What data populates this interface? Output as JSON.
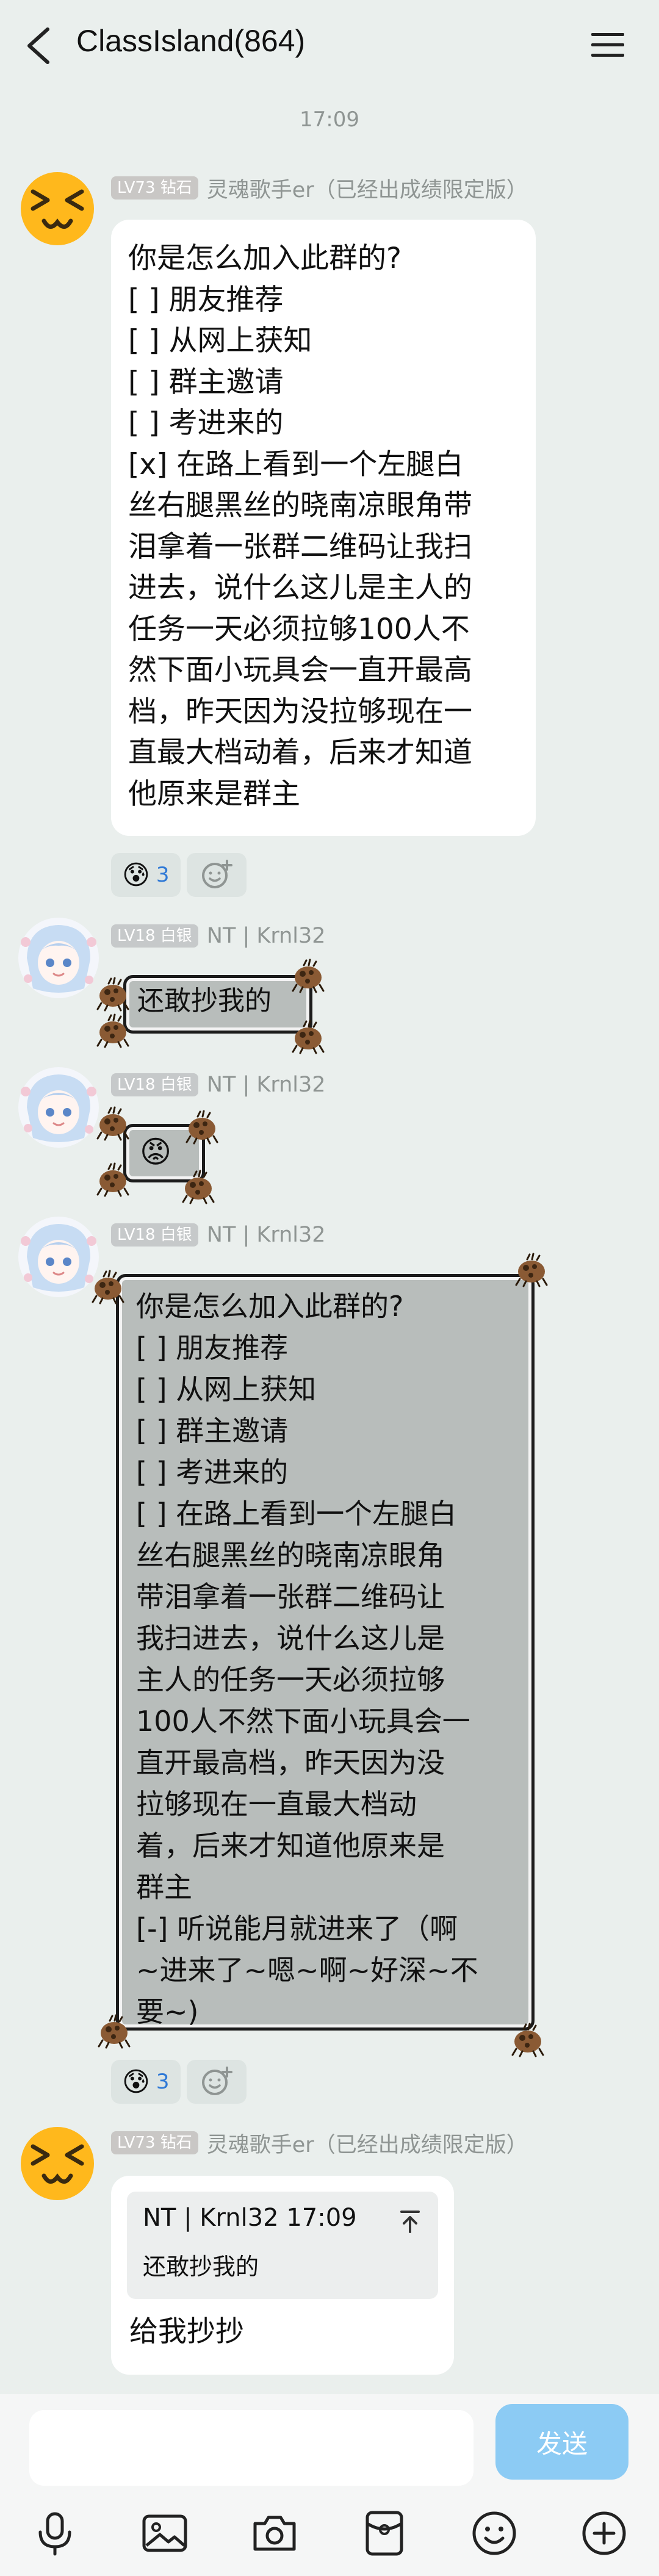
{
  "header": {
    "title": "ClassIsland(864)",
    "time": "17:09"
  },
  "messages": [
    {
      "level": "LV73 钻石",
      "nickname": "灵魂歌手er（已经出成绩限定版）",
      "avatar_icon": "squint-emoji-avatar",
      "text": "你是怎么加入此群的?\n[ ] 朋友推荐\n[ ] 从网上获知\n[ ] 群主邀请\n[ ] 考进来的\n[x] 在路上看到一个左腿白\n丝右腿黑丝的晓南凉眼角带\n泪拿着一张群二维码让我扫\n进去，说什么这儿是主人的\n任务一天必须拉够100人不\n然下面小玩具会一直开最高\n档，昨天因为没拉够现在一\n直最大档动着，后来才知道\n他原来是群主",
      "reaction": {
        "emoji": "😰",
        "count": "3"
      }
    },
    {
      "level": "LV18 白银",
      "nickname": "NT | Krnl32",
      "avatar_icon": "anime-girl-avatar",
      "text": "还敢抄我的"
    },
    {
      "level": "LV18 白银",
      "nickname": "NT | Krnl32",
      "avatar_icon": "anime-girl-avatar",
      "text": "😡"
    },
    {
      "level": "LV18 白银",
      "nickname": "NT | Krnl32",
      "avatar_icon": "anime-girl-avatar",
      "text": "你是怎么加入此群的?\n[ ] 朋友推荐\n[ ] 从网上获知\n[ ] 群主邀请\n[ ] 考进来的\n[ ] 在路上看到一个左腿白\n丝右腿黑丝的晓南凉眼角\n带泪拿着一张群二维码让\n我扫进去，说什么这儿是\n主人的任务一天必须拉够\n100人不然下面小玩具会一\n直开最高档，昨天因为没\n拉够现在一直最大档动\n着，后来才知道他原来是\n群主\n[-] 听说能月就进来了（啊\n~进来了~嗯~啊~好深~不\n要~)",
      "reaction": {
        "emoji": "😰",
        "count": "3"
      }
    },
    {
      "level": "LV73 钻石",
      "nickname": "灵魂歌手er（已经出成绩限定版）",
      "avatar_icon": "squint-emoji-avatar",
      "quote": {
        "meta": "NT | Krnl32 17:09",
        "text": "还敢抄我的"
      },
      "text": "给我抄抄"
    }
  ],
  "composer": {
    "placeholder": "",
    "send_label": "发送",
    "tools": [
      "microphone-icon",
      "image-icon",
      "camera-icon",
      "red-packet-icon",
      "emoji-icon",
      "plus-icon"
    ]
  },
  "colors": {
    "background": "#eaefed",
    "send_button": "#8ccbf4",
    "nickname": "#8f9593",
    "reaction_count": "#2f79d6"
  }
}
